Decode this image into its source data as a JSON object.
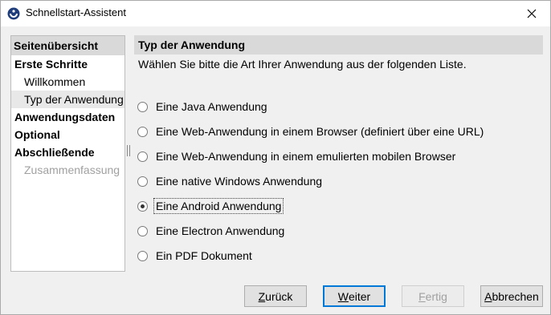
{
  "window": {
    "title": "Schnellstart-Assistent"
  },
  "sidebar": {
    "header": "Seitenübersicht",
    "items": [
      {
        "label": "Erste Schritte",
        "kind": "category"
      },
      {
        "label": "Willkommen",
        "kind": "sub"
      },
      {
        "label": "Typ der Anwendung",
        "kind": "sub",
        "selected": true
      },
      {
        "label": "Anwendungsdaten",
        "kind": "category"
      },
      {
        "label": "Optional",
        "kind": "category"
      },
      {
        "label": "Abschließende",
        "kind": "category"
      },
      {
        "label": "Zusammenfassung",
        "kind": "sub",
        "disabled": true
      }
    ]
  },
  "main": {
    "header": "Typ der Anwendung",
    "description": "Wählen Sie bitte die Art Ihrer Anwendung aus der folgenden Liste.",
    "options": [
      {
        "label": "Eine Java Anwendung",
        "checked": false
      },
      {
        "label": "Eine Web-Anwendung in einem Browser (definiert über eine URL)",
        "checked": false
      },
      {
        "label": "Eine Web-Anwendung in einem emulierten mobilen Browser",
        "checked": false
      },
      {
        "label": "Eine native Windows Anwendung",
        "checked": false
      },
      {
        "label": "Eine Android Anwendung",
        "checked": true
      },
      {
        "label": "Eine Electron Anwendung",
        "checked": false
      },
      {
        "label": "Ein PDF Dokument",
        "checked": false
      }
    ]
  },
  "buttons": {
    "back": {
      "mnemonic": "Z",
      "rest": "urück"
    },
    "next": {
      "mnemonic": "W",
      "rest": "eiter"
    },
    "finish": {
      "mnemonic": "F",
      "rest": "ertig"
    },
    "cancel": {
      "mnemonic": "A",
      "rest": "bbrechen"
    }
  },
  "colors": {
    "header_bg": "#d9d9d9",
    "accent": "#0078d7",
    "disabled_text": "#a0a0a0"
  }
}
